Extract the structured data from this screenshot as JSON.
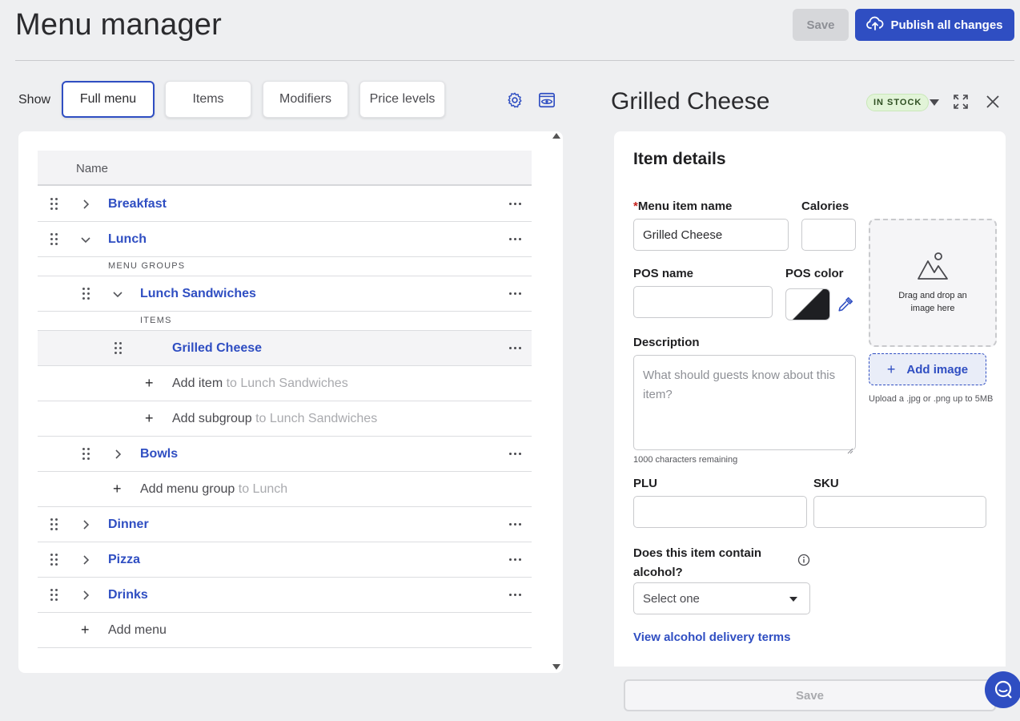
{
  "header": {
    "title": "Menu manager",
    "save_label": "Save",
    "publish_label": "Publish all changes"
  },
  "filters": {
    "show_label": "Show",
    "options": [
      "Full menu",
      "Items",
      "Modifiers",
      "Price levels"
    ],
    "active": "Full menu"
  },
  "tree": {
    "column_header": "Name",
    "rows": {
      "breakfast": "Breakfast",
      "lunch": "Lunch",
      "menu_groups_label": "MENU GROUPS",
      "lunch_sandwiches": "Lunch Sandwiches",
      "items_label": "ITEMS",
      "grilled_cheese": "Grilled Cheese",
      "add_item": "Add item",
      "add_item_target": "to Lunch Sandwiches",
      "add_subgroup": "Add subgroup",
      "add_subgroup_target": "to Lunch Sandwiches",
      "bowls": "Bowls",
      "add_menu_group": "Add menu group",
      "add_menu_group_target": "to Lunch",
      "dinner": "Dinner",
      "pizza": "Pizza",
      "drinks": "Drinks",
      "add_menu": "Add menu"
    }
  },
  "detail": {
    "title": "Grilled Cheese",
    "stock_status": "IN STOCK",
    "card_heading": "Item details",
    "menu_item_name_label": "Menu item name",
    "required_marker": "*",
    "menu_item_name_value": "Grilled Cheese",
    "calories_label": "Calories",
    "calories_value": "",
    "pos_name_label": "POS name",
    "pos_name_value": "",
    "pos_color_label": "POS color",
    "description_label": "Description",
    "description_placeholder": "What should guests know about this item?",
    "characters_remaining": "1000 characters remaining",
    "image_drop_text": "Drag and drop an image here",
    "add_image_label": "Add image",
    "upload_note": "Upload a .jpg or .png up to 5MB",
    "plu_label": "PLU",
    "sku_label": "SKU",
    "alcohol_question": "Does this item contain alcohol?",
    "alcohol_select": "Select one",
    "alcohol_terms_link": "View alcohol delivery terms",
    "footer_save_label": "Save"
  },
  "colors": {
    "accent": "#2f4ec2",
    "background": "#eeeff1",
    "in_stock_bg": "#e2f4d8",
    "pos_color_dark": "#1e1f22"
  }
}
